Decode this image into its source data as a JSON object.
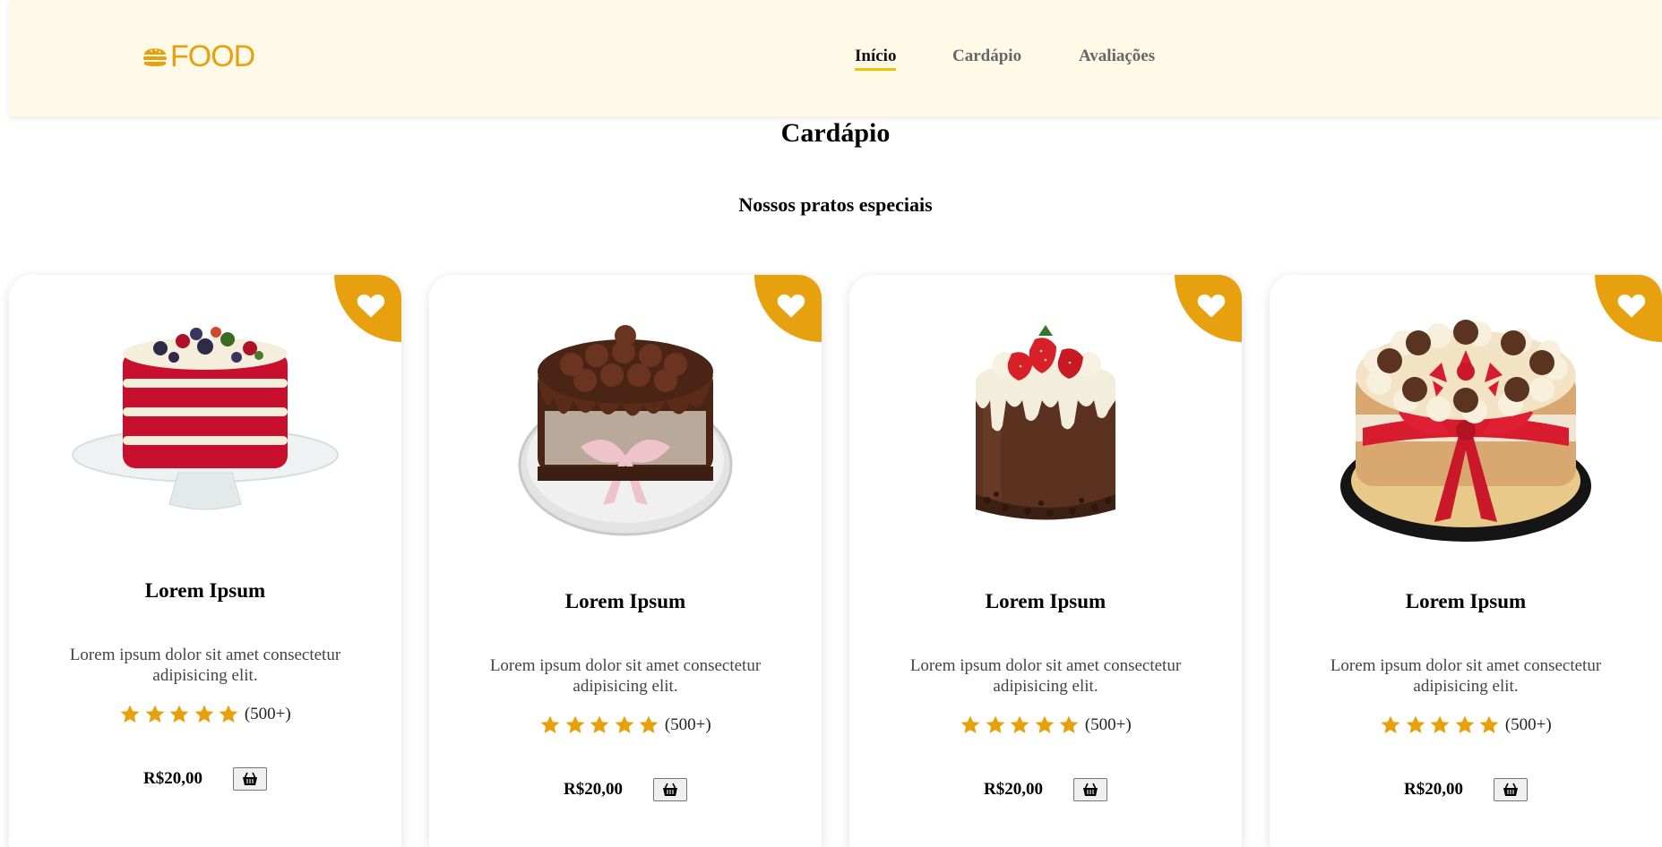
{
  "brand": {
    "logo_text": "FOOD",
    "accent_color": "#e8a10e",
    "header_bg": "#fff9e8"
  },
  "nav": {
    "items": [
      {
        "label": "Início",
        "active": true
      },
      {
        "label": "Cardápio",
        "active": false
      },
      {
        "label": "Avaliações",
        "active": false
      }
    ]
  },
  "menu": {
    "title": "Cardápio",
    "subtitle": "Nossos pratos especiais",
    "cards": [
      {
        "title": "Lorem Ipsum",
        "description": "Lorem ipsum dolor sit amet consectetur adipisicing elit.",
        "rating": 5,
        "rating_count": "(500+)",
        "price": "R$20,00",
        "image": "red-velvet-naked-cake"
      },
      {
        "title": "Lorem Ipsum",
        "description": "Lorem ipsum dolor sit amet consectetur adipisicing elit.",
        "rating": 5,
        "rating_count": "(500+)",
        "price": "R$20,00",
        "image": "brigadeiro-chocolate-cake"
      },
      {
        "title": "Lorem Ipsum",
        "description": "Lorem ipsum dolor sit amet consectetur adipisicing elit.",
        "rating": 5,
        "rating_count": "(500+)",
        "price": "R$20,00",
        "image": "chocolate-drip-strawberry-cake"
      },
      {
        "title": "Lorem Ipsum",
        "description": "Lorem ipsum dolor sit amet consectetur adipisicing elit.",
        "rating": 5,
        "rating_count": "(500+)",
        "price": "R$20,00",
        "image": "strawberry-ribbon-naked-cake"
      }
    ]
  },
  "icons": {
    "logo": "burger-icon",
    "favorite": "heart-icon",
    "rating": "star-icon",
    "cart": "basket-icon"
  }
}
